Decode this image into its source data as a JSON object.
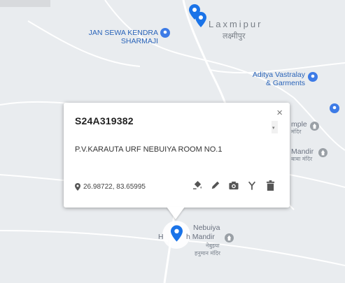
{
  "map": {
    "town": {
      "name": "Laxmipur",
      "name_local": "लक्ष्मीपुर"
    },
    "places": [
      {
        "id": "jan-sewa-kendra",
        "label_lines": [
          "JAN SEWA KENDRA",
          "SHARMAJI"
        ]
      },
      {
        "id": "aditya-vastralay",
        "label_lines": [
          "Aditya Vastralay",
          "& Garments"
        ]
      },
      {
        "id": "temple-right",
        "label_lines": [
          "mple"
        ],
        "sub_lines": [
          "मंदिर"
        ]
      },
      {
        "id": "baba-mandir",
        "label_lines": [
          "Mandir"
        ],
        "sub_lines": [
          "बाबा मंदिर"
        ]
      },
      {
        "id": "nebuiya-mandir",
        "label_lines": [
          "Nebuiya",
          "H",
          "h Mandir"
        ],
        "sub_lines": [
          "नेबुइया",
          "हनुमान मंदिर"
        ]
      }
    ],
    "colors": {
      "pin": "#1a73e8",
      "poi": "#2a64b9",
      "road": "#ffffff",
      "background": "#e9ecef"
    }
  },
  "popup": {
    "title": "S24A319382",
    "address": "P.V.KARAUTA URF NEBUIYA ROOM NO.1",
    "coordinates": "26.98722, 83.65995",
    "close_label": "×",
    "tools": [
      {
        "name": "paint-bucket-icon"
      },
      {
        "name": "pencil-icon"
      },
      {
        "name": "camera-icon"
      },
      {
        "name": "fork-icon"
      },
      {
        "name": "trash-icon"
      }
    ]
  }
}
